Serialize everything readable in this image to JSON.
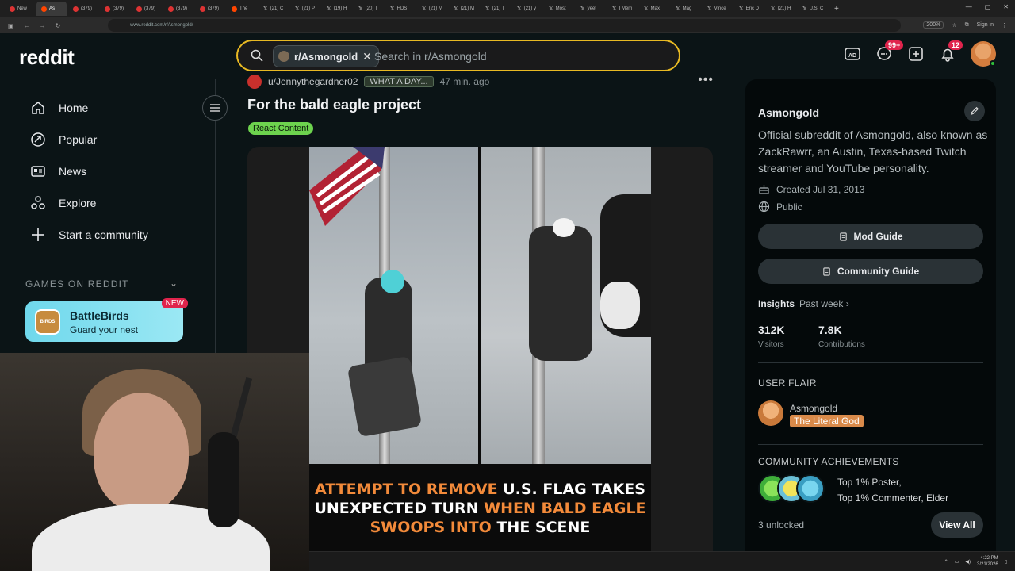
{
  "browser": {
    "tabs": [
      {
        "label": "New",
        "icon": "youtube-icon"
      },
      {
        "label": "As",
        "icon": "reddit-icon",
        "active": true
      },
      {
        "label": "(379)",
        "icon": "youtube-icon"
      },
      {
        "label": "(379)",
        "icon": "youtube-icon"
      },
      {
        "label": "(379)",
        "icon": "youtube-icon"
      },
      {
        "label": "(379)",
        "icon": "youtube-icon"
      },
      {
        "label": "(379)",
        "icon": "youtube-icon"
      },
      {
        "label": "The",
        "icon": "reddit-icon"
      },
      {
        "label": "(21) C",
        "icon": "x-icon"
      },
      {
        "label": "(21) P",
        "icon": "x-icon"
      },
      {
        "label": "(19) H",
        "icon": "x-icon"
      },
      {
        "label": "(20) T",
        "icon": "x-icon"
      },
      {
        "label": "HDS",
        "icon": "x-icon"
      },
      {
        "label": "(21) M",
        "icon": "x-icon"
      },
      {
        "label": "(21) M",
        "icon": "x-icon"
      },
      {
        "label": "(21) T",
        "icon": "x-icon"
      },
      {
        "label": "(21) y",
        "icon": "x-icon"
      },
      {
        "label": "Most",
        "icon": "x-icon"
      },
      {
        "label": "yeet",
        "icon": "x-icon"
      },
      {
        "label": "I Mem",
        "icon": "x-icon"
      },
      {
        "label": "Max",
        "icon": "x-icon"
      },
      {
        "label": "Mag",
        "icon": "x-icon"
      },
      {
        "label": "Vince",
        "icon": "x-icon"
      },
      {
        "label": "Eric D",
        "icon": "x-icon"
      },
      {
        "label": "(21) H",
        "icon": "x-icon"
      },
      {
        "label": "U.S. C",
        "icon": "x-icon"
      }
    ],
    "url": "www.reddit.com/r/Asmongold/",
    "zoom": "200%",
    "signin": "Sign in"
  },
  "header": {
    "logo": "reddit",
    "search_chip": "r/Asmongold",
    "search_placeholder": "Search in r/Asmongold",
    "chat_badge": "99+",
    "notif_badge": "12"
  },
  "sidebar": {
    "items": [
      {
        "label": "Home",
        "icon": "home-icon"
      },
      {
        "label": "Popular",
        "icon": "popular-icon"
      },
      {
        "label": "News",
        "icon": "news-icon"
      },
      {
        "label": "Explore",
        "icon": "explore-icon"
      },
      {
        "label": "Start a community",
        "icon": "plus-icon"
      }
    ],
    "games_heading": "GAMES ON REDDIT",
    "game": {
      "title": "BattleBirds",
      "subtitle": "Guard your nest",
      "badge": "NEW"
    }
  },
  "post": {
    "author": "u/Jennythegardner02",
    "author_flair": "WHAT A DAY...",
    "time": "47 min. ago",
    "title": "For the bald eagle project",
    "flair": "React Content",
    "caption": {
      "p1": "ATTEMPT TO REMOVE",
      "p2": " U.S. FLAG TAKES UNEXPECTED TURN ",
      "p3": "WHEN BALD EAGLE SWOOPS INTO",
      "p4": " THE SCENE"
    }
  },
  "community": {
    "name": "Asmongold",
    "description": "Official subreddit of Asmongold, also known as ZackRawrr, an Austin, Texas-based Twitch streamer and YouTube personality.",
    "created": "Created Jul 31, 2013",
    "visibility": "Public",
    "mod_guide": "Mod Guide",
    "community_guide": "Community Guide",
    "insights_label": "Insights",
    "insights_period": "Past week",
    "visitors_value": "312K",
    "visitors_label": "Visitors",
    "contrib_value": "7.8K",
    "contrib_label": "Contributions",
    "user_flair_heading": "USER FLAIR",
    "flair_user": "Asmongold",
    "flair_tag": "The Literal God",
    "achievements_heading": "COMMUNITY ACHIEVEMENTS",
    "achievement1": "Top 1% Poster,",
    "achievement2": "Top 1% Commenter, Elder",
    "unlocked": "3 unlocked",
    "view_all": "View All"
  },
  "taskbar": {
    "time": "4:22 PM",
    "date": "3/21/2026"
  },
  "colors": {
    "search_border": "#e8b923",
    "flair_green": "#6dd34e",
    "badge_red": "#e0244c",
    "caption_orange": "#f28a3a"
  }
}
